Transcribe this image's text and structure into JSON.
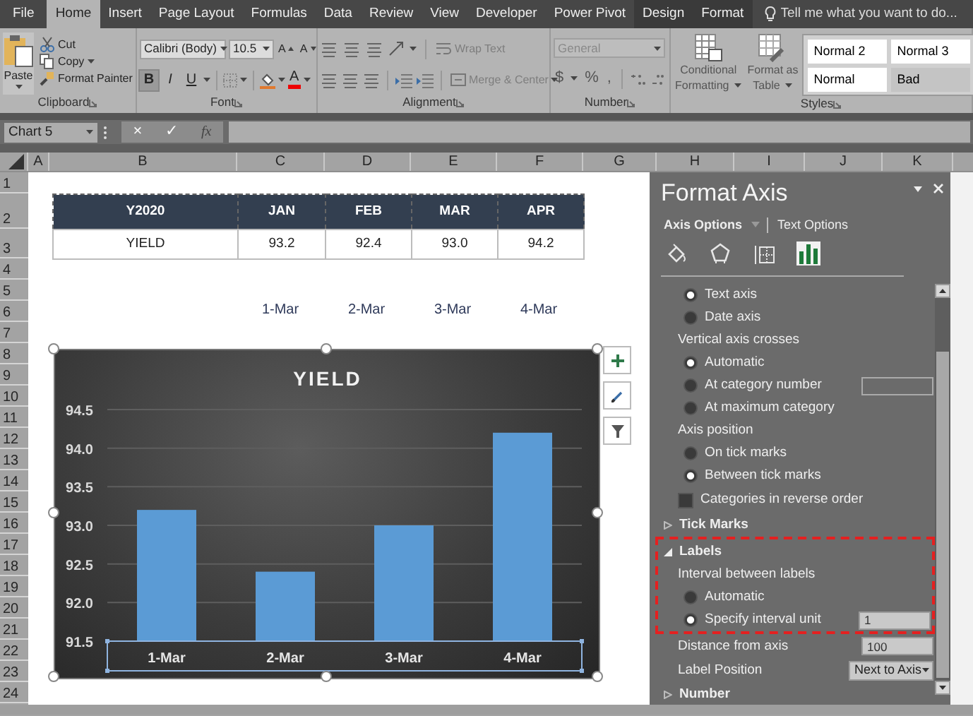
{
  "ribbon_tabs": [
    {
      "label": "File",
      "kind": "file",
      "selected": false
    },
    {
      "label": "Home",
      "kind": "standard",
      "selected": true
    },
    {
      "label": "Insert",
      "kind": "standard",
      "selected": false
    },
    {
      "label": "Page Layout",
      "kind": "standard",
      "selected": false
    },
    {
      "label": "Formulas",
      "kind": "standard",
      "selected": false
    },
    {
      "label": "Data",
      "kind": "standard",
      "selected": false
    },
    {
      "label": "Review",
      "kind": "standard",
      "selected": false
    },
    {
      "label": "View",
      "kind": "standard",
      "selected": false
    },
    {
      "label": "Developer",
      "kind": "standard",
      "selected": false
    },
    {
      "label": "Power Pivot",
      "kind": "standard",
      "selected": false
    },
    {
      "label": "Design",
      "kind": "contextual",
      "selected": false
    },
    {
      "label": "Format",
      "kind": "contextual",
      "selected": false
    }
  ],
  "tell_me": {
    "placeholder": "Tell me what you want to do..."
  },
  "ribbon": {
    "clipboard": {
      "paste": "Paste",
      "cut": "Cut",
      "copy": "Copy",
      "format_painter": "Format Painter",
      "label": "Clipboard"
    },
    "font": {
      "font_name": "Calibri (Body)",
      "font_size": "10.5",
      "grow": "A",
      "shrink": "A",
      "style_buttons": [
        {
          "label": "B",
          "kind": "bold",
          "pressed": true
        },
        {
          "label": "I",
          "kind": "italic",
          "pressed": false
        },
        {
          "label": "U",
          "kind": "underline",
          "pressed": false
        }
      ],
      "font_color": "A",
      "label": "Font"
    },
    "alignment": {
      "wrap_text": {
        "label": "Wrap Text",
        "disabled": true
      },
      "merge": {
        "label": "Merge & Center",
        "disabled": true
      },
      "label": "Alignment"
    },
    "number": {
      "format": {
        "value": "General",
        "disabled": true
      },
      "currency": "$",
      "percent": "%",
      "comma": ",",
      "label": "Number"
    },
    "styles": {
      "conditional": [
        "Conditional",
        "Formatting"
      ],
      "format_table": [
        "Format as",
        "Table"
      ],
      "gallery": [
        {
          "label": "Normal 2",
          "color": "#ffffff"
        },
        {
          "label": "Normal 3",
          "color": "#ffffff"
        },
        {
          "label": "Normal",
          "color": "#ffffff"
        },
        {
          "label": "Bad",
          "color": "#c4c4c4"
        }
      ],
      "label": "Styles"
    }
  },
  "formula_bar": {
    "name_box": "Chart 5",
    "cancel": "×",
    "enter": "✓",
    "function": "fx"
  },
  "column_headers": [
    "A",
    "B",
    "C",
    "D",
    "E",
    "F",
    "G",
    "H",
    "I",
    "J",
    "K"
  ],
  "row_headers": [
    "1",
    "2",
    "3",
    "4",
    "5",
    "6",
    "7",
    "8",
    "9",
    "10",
    "11",
    "12",
    "13",
    "14",
    "15",
    "16",
    "17",
    "18",
    "19",
    "20",
    "21",
    "22",
    "23",
    "24"
  ],
  "sheet_table": {
    "header": [
      "Y2020",
      "JAN",
      "FEB",
      "MAR",
      "APR"
    ],
    "row": [
      "YIELD",
      "93.2",
      "92.4",
      "93.0",
      "94.2"
    ]
  },
  "date_labels": [
    "1-Mar",
    "2-Mar",
    "3-Mar",
    "4-Mar"
  ],
  "chart": {
    "chart_data": {
      "type": "bar",
      "title": "YIELD",
      "categories": [
        "1-Mar",
        "2-Mar",
        "3-Mar",
        "4-Mar"
      ],
      "series": [
        {
          "color": "#5b9bd5",
          "values": [
            93.2,
            92.4,
            93.0,
            94.2
          ]
        }
      ],
      "grid": true,
      "ylim": [
        91.5,
        94.5
      ],
      "yticks": [
        {
          "value": 91.5,
          "label": "91.5"
        },
        {
          "value": 92,
          "label": "92.0"
        },
        {
          "value": 92.5,
          "label": "92.5"
        },
        {
          "value": 93,
          "label": "93.0"
        },
        {
          "value": 93.5,
          "label": "93.5"
        },
        {
          "value": 94,
          "label": "94.0"
        },
        {
          "value": 94.5,
          "label": "94.5"
        }
      ]
    }
  },
  "format_pane": {
    "title": "Format Axis",
    "tabs": [
      {
        "label": "Axis Options",
        "selected": true
      },
      {
        "label": "Text Options",
        "selected": false
      }
    ],
    "icon_tabs": [
      {
        "kind": "fill",
        "selected": false
      },
      {
        "kind": "effects",
        "selected": false
      },
      {
        "kind": "size",
        "selected": false
      },
      {
        "kind": "axis",
        "selected": true
      }
    ],
    "options": [
      {
        "kind": "radio",
        "label": "Text axis",
        "checked": true
      },
      {
        "kind": "radio",
        "label": "Date axis",
        "checked": false
      },
      {
        "kind": "heading",
        "label": "Vertical axis crosses"
      },
      {
        "kind": "radio",
        "label": "Automatic",
        "checked": true
      },
      {
        "kind": "radio",
        "label": "At category number",
        "checked": false,
        "input_box": true
      },
      {
        "kind": "radio",
        "label": "At maximum category",
        "checked": false
      },
      {
        "kind": "heading",
        "label": "Axis position"
      },
      {
        "kind": "radio",
        "label": "On tick marks",
        "checked": false
      },
      {
        "kind": "radio",
        "label": "Between tick marks",
        "checked": true
      },
      {
        "kind": "checkbox",
        "label": "Categories in reverse order",
        "checked": false
      },
      {
        "kind": "section",
        "label": "Tick Marks",
        "expanded": false
      },
      {
        "kind": "highlight",
        "items": [
          {
            "kind": "section",
            "label": "Labels",
            "expanded": true
          },
          {
            "kind": "heading",
            "label": "Interval between labels"
          },
          {
            "kind": "radio",
            "label": "Automatic",
            "checked": false
          },
          {
            "kind": "radio",
            "label": "Specify interval unit",
            "checked": true,
            "value": "1"
          }
        ]
      },
      {
        "kind": "field",
        "label": "Distance from axis",
        "value": "100"
      },
      {
        "kind": "select",
        "label": "Label Position",
        "value": "Next to Axis"
      },
      {
        "kind": "section",
        "label": "Number",
        "expanded": false
      }
    ]
  }
}
